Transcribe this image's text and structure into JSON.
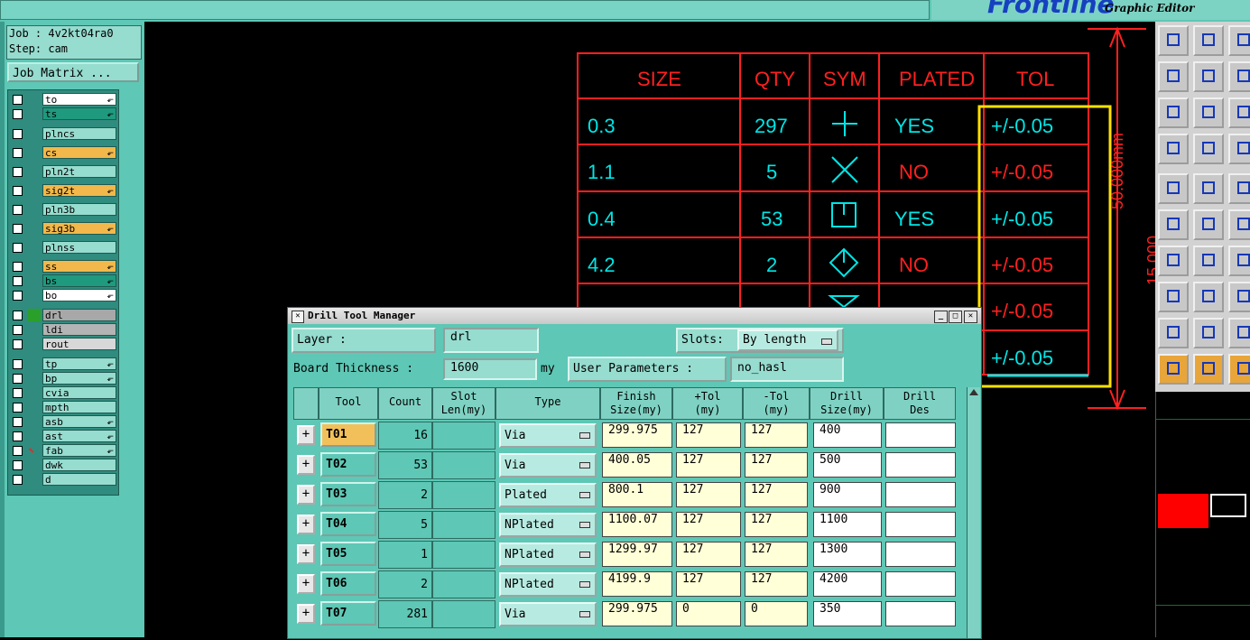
{
  "app": {
    "brand": "Frontline",
    "subtitle": "Graphic Editor"
  },
  "job": {
    "job_line": "Job : 4v2kt04ra0",
    "step_line": "Step: cam",
    "matrix_label": "Job Matrix ..."
  },
  "layers": [
    {
      "name": "to",
      "color": "#ffffff",
      "arrow": true
    },
    {
      "name": "ts",
      "color": "#1f9a7e",
      "arrow": true
    },
    {
      "name": "plncs",
      "color": "#96dccf",
      "arrow": false
    },
    {
      "name": "cs",
      "color": "#f2b84b",
      "arrow": true
    },
    {
      "name": "pln2t",
      "color": "#96dccf",
      "arrow": false
    },
    {
      "name": "sig2t",
      "color": "#f2b84b",
      "arrow": true
    },
    {
      "name": "pln3b",
      "color": "#96dccf",
      "arrow": false
    },
    {
      "name": "sig3b",
      "color": "#f2b84b",
      "arrow": true
    },
    {
      "name": "plnss",
      "color": "#96dccf",
      "arrow": false
    },
    {
      "name": "ss",
      "color": "#f2b84b",
      "arrow": true
    },
    {
      "name": "bs",
      "color": "#1f9a7e",
      "arrow": true
    },
    {
      "name": "bo",
      "color": "#ffffff",
      "arrow": true
    },
    {
      "name": "drl",
      "color": "#a8a8a8",
      "arrow": false
    },
    {
      "name": "ldi",
      "color": "#b4b4b4",
      "arrow": false
    },
    {
      "name": "rout",
      "color": "#d8d8d8",
      "arrow": false
    },
    {
      "name": "tp",
      "color": "#96dccf",
      "arrow": true
    },
    {
      "name": "bp",
      "color": "#96dccf",
      "arrow": true
    },
    {
      "name": "cvia",
      "color": "#96dccf",
      "arrow": false
    },
    {
      "name": "mpth",
      "color": "#96dccf",
      "arrow": false
    },
    {
      "name": "asb",
      "color": "#96dccf",
      "arrow": true
    },
    {
      "name": "ast",
      "color": "#96dccf",
      "arrow": true
    },
    {
      "name": "fab",
      "color": "#96dccf",
      "arrow": true
    },
    {
      "name": "dwk",
      "color": "#96dccf",
      "arrow": false
    },
    {
      "name": "d",
      "color": "#96dccf",
      "arrow": false
    }
  ],
  "drill_table": {
    "headers": [
      "SIZE",
      "QTY",
      "SYM",
      "PLATED",
      "TOL"
    ],
    "rows": [
      {
        "size": "0.3",
        "qty": "297",
        "plated": "YES",
        "tol": "+/-0.05",
        "sym": "plus"
      },
      {
        "size": "1.1",
        "qty": "5",
        "plated": "NO",
        "tol": "+/-0.05",
        "sym": "cross"
      },
      {
        "size": "0.4",
        "qty": "53",
        "plated": "YES",
        "tol": "+/-0.05",
        "sym": "square"
      },
      {
        "size": "4.2",
        "qty": "2",
        "plated": "NO",
        "tol": "+/-0.05",
        "sym": "diamond"
      }
    ],
    "extra_tols": [
      "+/-0.05",
      "+/-0.05"
    ],
    "dimension": "50.000mm",
    "dimension2": "15.000"
  },
  "dialog": {
    "title": "Drill Tool Manager",
    "layer_label": "Layer             :",
    "layer_value": "drl",
    "slots_label": "Slots:",
    "slots_value": "By length",
    "thickness_label": "Board Thickness :",
    "thickness_value": "1600",
    "thickness_unit": "my",
    "user_params_label": "User Parameters :",
    "user_params_value": "no_hasl",
    "columns": [
      "Tool",
      "Count",
      "Slot\nLen(my)",
      "Type",
      "Finish\nSize(my)",
      "+Tol\n(my)",
      "-Tol\n(my)",
      "Drill\nSize(my)",
      "Drill\nDes"
    ],
    "rows": [
      {
        "tool": "T01",
        "count": "16",
        "type": "Via",
        "finish": "299.975",
        "ptol": "127",
        "ntol": "127",
        "drill": "400"
      },
      {
        "tool": "T02",
        "count": "53",
        "type": "Via",
        "finish": "400.05",
        "ptol": "127",
        "ntol": "127",
        "drill": "500"
      },
      {
        "tool": "T03",
        "count": "2",
        "type": "Plated",
        "finish": "800.1",
        "ptol": "127",
        "ntol": "127",
        "drill": "900"
      },
      {
        "tool": "T04",
        "count": "5",
        "type": "NPlated",
        "finish": "1100.07",
        "ptol": "127",
        "ntol": "127",
        "drill": "1100"
      },
      {
        "tool": "T05",
        "count": "1",
        "type": "NPlated",
        "finish": "1299.97",
        "ptol": "127",
        "ntol": "127",
        "drill": "1300"
      },
      {
        "tool": "T06",
        "count": "2",
        "type": "NPlated",
        "finish": "4199.9",
        "ptol": "127",
        "ntol": "127",
        "drill": "4200"
      },
      {
        "tool": "T07",
        "count": "281",
        "type": "Via",
        "finish": "299.975",
        "ptol": "0",
        "ntol": "0",
        "drill": "350"
      }
    ]
  },
  "colors": {
    "teal": "#5ec7b5",
    "red": "#ff2020",
    "cyan": "#00e6e6",
    "highlight": "#ffe000",
    "arrow": "#f08080"
  }
}
